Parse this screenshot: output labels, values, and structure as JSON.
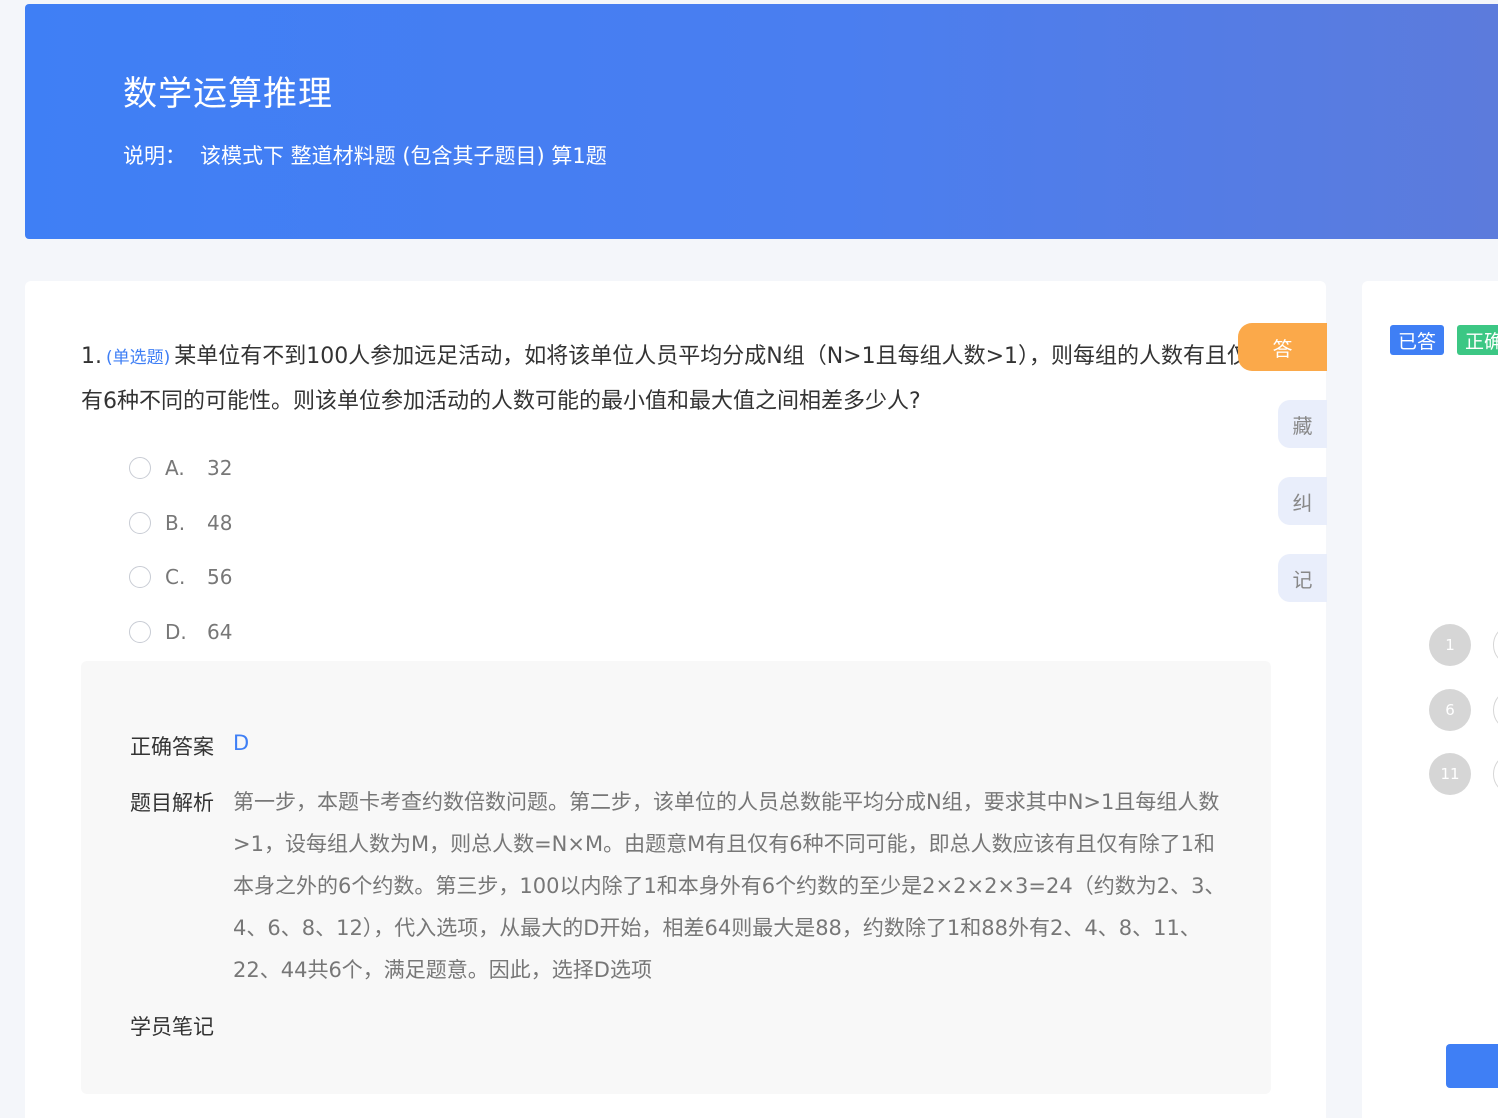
{
  "banner": {
    "title": "数学运算推理",
    "desc_label": "说明：",
    "desc_text": "该模式下 整道材料题 (包含其子题目) 算1题"
  },
  "question": {
    "number": "1.",
    "type": "(单选题)",
    "text": "某单位有不到100人参加远足活动，如将该单位人员平均分成N组（N>1且每组人数>1），则每组的人数有且仅有6种不同的可能性。则该单位参加活动的人数可能的最小值和最大值之间相差多少人?",
    "options": [
      {
        "letter": "A.",
        "value": "32"
      },
      {
        "letter": "B.",
        "value": "48"
      },
      {
        "letter": "C.",
        "value": "56"
      },
      {
        "letter": "D.",
        "value": "64"
      }
    ]
  },
  "analysis": {
    "answer_label": "正确答案",
    "answer_value": "D",
    "explain_label": "题目解析",
    "explain_text": "第一步，本题卡考查约数倍数问题。第二步，该单位的人员总数能平均分成N组，要求其中N>1且每组人数>1，设每组人数为M，则总人数=N×M。由题意M有且仅有6种不同可能，即总人数应该有且仅有除了1和本身之外的6个约数。第三步，100以内除了1和本身外有6个约数的至少是2×2×2×3=24（约数为2、3、4、6、8、12），代入选项，从最大的D开始，相差64则最大是88，约数除了1和88外有2、4、8、11、22、44共6个，满足题意。因此，选择D选项",
    "notes_label": "学员笔记"
  },
  "side_buttons": {
    "answer": "答",
    "collect": "藏",
    "correct": "纠",
    "note": "记"
  },
  "answer_card": {
    "legend_answered": "已答",
    "legend_correct": "正确",
    "numbers": [
      "1",
      "6",
      "11"
    ]
  },
  "colors": {
    "accent": "#3f7ff5",
    "answer_button": "#fba94a",
    "legend_correct": "#3cc784"
  }
}
